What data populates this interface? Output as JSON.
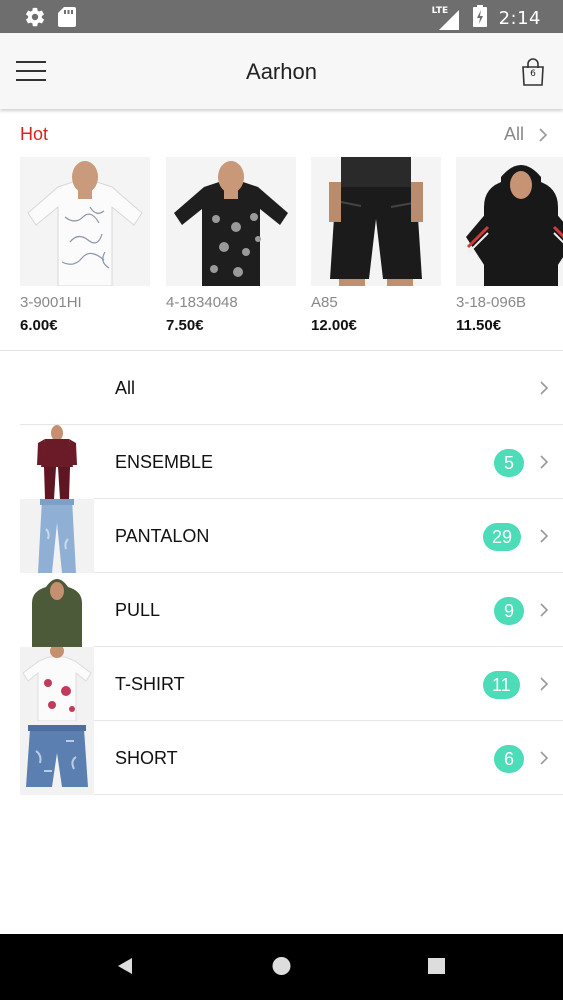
{
  "status_bar": {
    "time": "2:14",
    "network": "LTE",
    "icons": [
      "settings-icon",
      "sd-card-icon",
      "signal-icon",
      "battery-charging-icon"
    ]
  },
  "app_bar": {
    "title": "Aarhon",
    "cart_count": "6",
    "icons": [
      "hamburger-menu-icon",
      "shopping-bag-icon"
    ]
  },
  "hot_section": {
    "title": "Hot",
    "all_label": "All",
    "products": [
      {
        "code": "3-9001HI",
        "price": "6.00€",
        "image": "white floral t-shirt"
      },
      {
        "code": "4-1834048",
        "price": "7.50€",
        "image": "black patterned t-shirt"
      },
      {
        "code": "A85",
        "price": "12.00€",
        "image": "black denim shorts"
      },
      {
        "code": "3-18-096B",
        "price": "11.50€",
        "image": "black hoodie with red stripes"
      }
    ]
  },
  "categories": [
    {
      "label": "All",
      "count": null,
      "image": null
    },
    {
      "label": "ENSEMBLE",
      "count": "5",
      "image": "burgundy tracksuit"
    },
    {
      "label": "PANTALON",
      "count": "29",
      "image": "light blue jeans"
    },
    {
      "label": "PULL",
      "count": "9",
      "image": "olive hoodie"
    },
    {
      "label": "T-SHIRT",
      "count": "11",
      "image": "white floral t-shirt"
    },
    {
      "label": "SHORT",
      "count": "6",
      "image": "blue denim shorts"
    }
  ],
  "colors": {
    "hot_red": "#e02020",
    "badge_teal": "#4ddcb8",
    "status_bar": "#6e6e6e",
    "nav_bar": "#000000"
  },
  "nav_bar": {
    "icons": [
      "back-icon",
      "home-icon",
      "recents-icon"
    ]
  }
}
